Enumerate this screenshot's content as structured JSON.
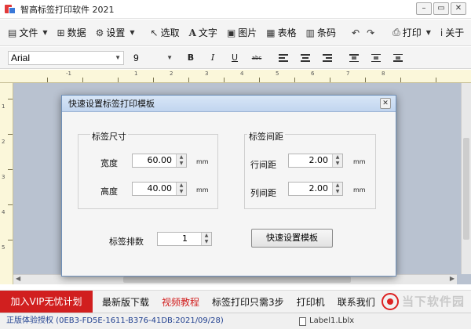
{
  "window": {
    "title": "智高标签打印软件 2021",
    "controls": [
      "–",
      "▭",
      "✕"
    ]
  },
  "toolbar": {
    "file": "文件",
    "data": "数据",
    "settings": "设置",
    "select": "选取",
    "text": "文字",
    "image": "图片",
    "table": "表格",
    "barcode": "条码",
    "print": "打印",
    "about": "关于"
  },
  "formatbar": {
    "font": "Arial",
    "size": "9",
    "bold": "B",
    "italic": "I",
    "underline": "U",
    "strike": "abc"
  },
  "ruler": {
    "top_labels": [
      "-1",
      "1",
      "2",
      "3",
      "4",
      "5",
      "6",
      "7",
      "8"
    ],
    "left_labels": [
      "1",
      "2",
      "3",
      "4",
      "5"
    ]
  },
  "dialog": {
    "title": "快速设置标签打印模板",
    "close": "✕",
    "size_group": {
      "title": "标签尺寸",
      "width_label": "宽度",
      "width_value": "60.00",
      "height_label": "高度",
      "height_value": "40.00",
      "unit": "mm"
    },
    "spacing_group": {
      "title": "标签间距",
      "row_label": "行间距",
      "row_value": "2.00",
      "col_label": "列间距",
      "col_value": "2.00",
      "unit": "mm"
    },
    "rows_label": "标签排数",
    "rows_value": "1",
    "quick_button": "快速设置模板"
  },
  "promo": {
    "vip": "加入VIP无忧计划",
    "links": [
      {
        "label": "最新版下载",
        "color": "#111111"
      },
      {
        "label": "视频教程",
        "color": "#d11f1f"
      },
      {
        "label": "标签打印只需3步",
        "color": "#111111"
      },
      {
        "label": "打印机",
        "color": "#111111"
      },
      {
        "label": "联系我们",
        "color": "#111111"
      }
    ],
    "watermark": "当下软件园"
  },
  "status": {
    "license": "正版体验授权 (0EB3-FD5E-1611-B376-41DB:2021/09/28)",
    "file": "Label1.Lblx"
  },
  "colors": {
    "accent_red": "#d11f1f",
    "canvas_bg": "#b9c2d0",
    "ruler_bg": "#fbf7da"
  }
}
